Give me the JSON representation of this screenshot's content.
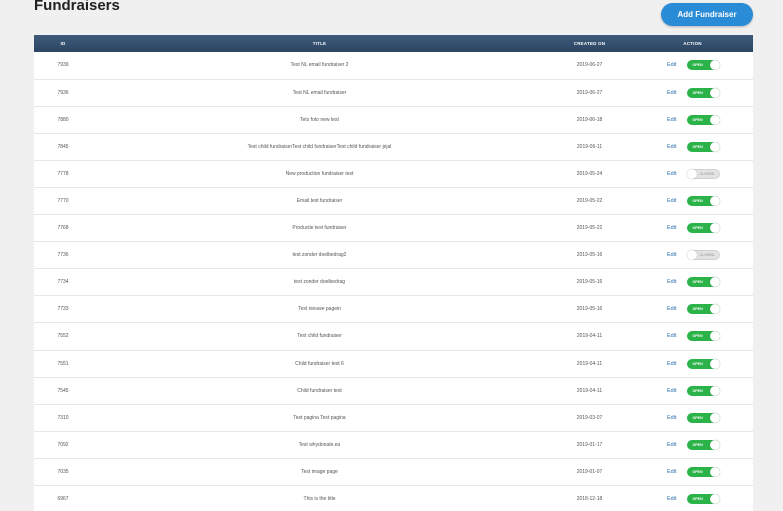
{
  "header": {
    "title": "Fundraisers",
    "add_button_label": "Add Fundraiser"
  },
  "table": {
    "columns": {
      "id": "ID",
      "title": "TITLE",
      "created": "CREATED ON",
      "action": "ACTION"
    },
    "edit_label": "Edit",
    "rows": [
      {
        "id": "7939",
        "title": "Test NL email fundraiser 2",
        "created": "2019-06-27",
        "status": "OPEN",
        "on": true
      },
      {
        "id": "7936",
        "title": "Test NL email fundraiser",
        "created": "2019-06-27",
        "status": "OPEN",
        "on": true
      },
      {
        "id": "7880",
        "title": "Tets foto new test",
        "created": "2019-06-18",
        "status": "OPEN",
        "on": true
      },
      {
        "id": "7845",
        "title": "Test child fundraiserTest child fundraiserTest child fundraiser jejal",
        "created": "2019-06-11",
        "status": "OPEN",
        "on": true
      },
      {
        "id": "7778",
        "title": "New production fundraiser test",
        "created": "2019-05-24",
        "status": "CLOSED",
        "on": false
      },
      {
        "id": "7770",
        "title": "Email test fundraiser",
        "created": "2019-05-22",
        "status": "OPEN",
        "on": true
      },
      {
        "id": "7768",
        "title": "Productie test fundraiser",
        "created": "2019-05-22",
        "status": "OPEN",
        "on": true
      },
      {
        "id": "7736",
        "title": "test zonder doelbedrag2",
        "created": "2019-05-16",
        "status": "CLOSED",
        "on": false
      },
      {
        "id": "7734",
        "title": "test zonder doelbedrag",
        "created": "2019-05-16",
        "status": "OPEN",
        "on": true
      },
      {
        "id": "7733",
        "title": "Test nieuwe pagein",
        "created": "2019-05-16",
        "status": "OPEN",
        "on": true
      },
      {
        "id": "7552",
        "title": "Test child fundraiser",
        "created": "2019-04-11",
        "status": "OPEN",
        "on": true
      },
      {
        "id": "7551",
        "title": "Child fundraiser test 6",
        "created": "2019-04-11",
        "status": "OPEN",
        "on": true
      },
      {
        "id": "7545",
        "title": "Child fundraiser test",
        "created": "2019-04-11",
        "status": "OPEN",
        "on": true
      },
      {
        "id": "7310",
        "title": "Test pagina Test pagina",
        "created": "2019-03-07",
        "status": "OPEN",
        "on": true
      },
      {
        "id": "7092",
        "title": "Test whydonate.eu",
        "created": "2019-01-17",
        "status": "OPEN",
        "on": true
      },
      {
        "id": "7035",
        "title": "Test image page",
        "created": "2019-01-07",
        "status": "OPEN",
        "on": true
      },
      {
        "id": "6967",
        "title": "This is the title",
        "created": "2018-12-18",
        "status": "OPEN",
        "on": true
      }
    ]
  },
  "colors": {
    "header_bg": "#2c4663",
    "toggle_on": "#2bb34a",
    "button": "#2a8bd6",
    "link": "#2a6fb0"
  }
}
